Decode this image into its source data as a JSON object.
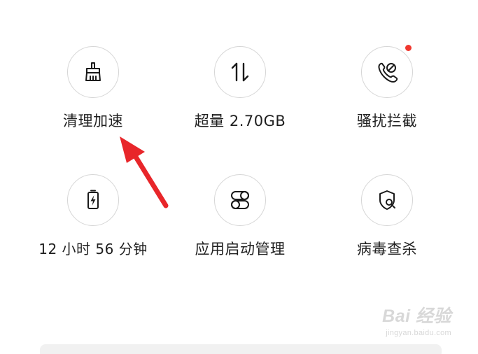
{
  "tiles": {
    "clean": {
      "label": "清理加速",
      "icon": "broom-icon"
    },
    "data": {
      "label": "超量 2.70GB",
      "icon": "data-transfer-icon"
    },
    "block": {
      "label": "骚扰拦截",
      "icon": "call-block-icon",
      "badge": true
    },
    "battery": {
      "label": "12 小时 56 分钟",
      "icon": "battery-charging-icon"
    },
    "startup": {
      "label": "应用启动管理",
      "icon": "toggle-switches-icon"
    },
    "virus": {
      "label": "病毒查杀",
      "icon": "shield-search-icon"
    }
  },
  "watermark": {
    "main": "Bai 经验",
    "sub": "jingyan.baidu.com"
  },
  "colors": {
    "text": "#1f1f1f",
    "circle_border": "#d6d6d6",
    "badge": "#f0372e",
    "arrow": "#e8262a"
  }
}
